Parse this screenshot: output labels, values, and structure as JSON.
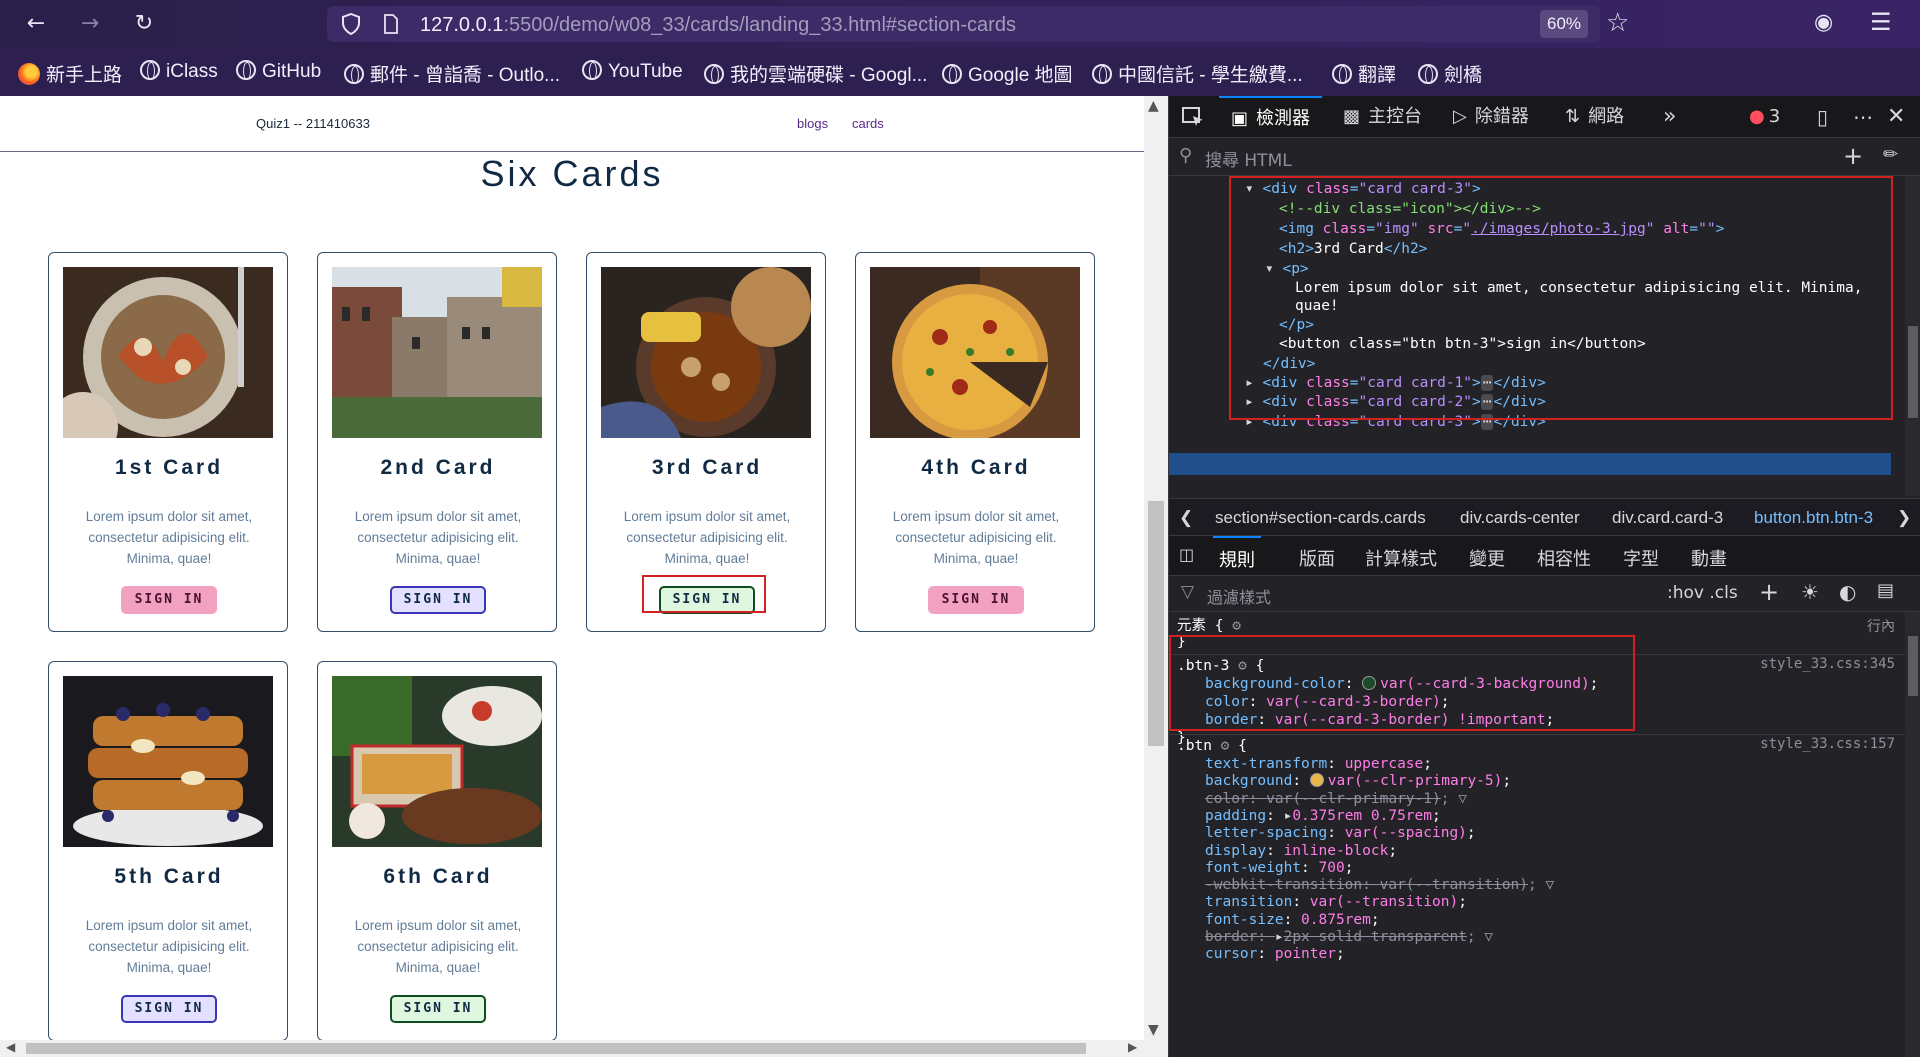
{
  "browser": {
    "url_host": "127.0.0.1",
    "url_rest": ":5500/demo/w08_33/cards/landing_33.html#section-cards",
    "zoom": "60%",
    "bookmarks": [
      "新手上路",
      "iClass",
      "GitHub",
      "郵件 - 曾詣喬 - Outlo...",
      "YouTube",
      "我的雲端硬碟 - Googl...",
      "Google 地圖",
      "中國信託 - 學生繳費...",
      "翻譯",
      "劍橋"
    ]
  },
  "page": {
    "logo": "Quiz1 -- 211410633",
    "nav_links": [
      "blogs",
      "cards"
    ],
    "title": "Six Cards",
    "cards": [
      {
        "title": "1st Card",
        "text": "Lorem ipsum dolor sit amet, consectetur adipisicing elit. Minima, quae!",
        "button": "SIGN IN",
        "btn_class": "btn-1",
        "photo": "pasta"
      },
      {
        "title": "2nd Card",
        "text": "Lorem ipsum dolor sit amet, consectetur adipisicing elit. Minima, quae!",
        "button": "SIGN IN",
        "btn_class": "btn-2",
        "photo": "buildings"
      },
      {
        "title": "3rd Card",
        "text": "Lorem ipsum dolor sit amet, consectetur adipisicing elit. Minima, quae!",
        "button": "SIGN IN",
        "btn_class": "btn-3",
        "photo": "stew"
      },
      {
        "title": "4th Card",
        "text": "Lorem ipsum dolor sit amet, consectetur adipisicing elit. Minima, quae!",
        "button": "SIGN IN",
        "btn_class": "btn-1",
        "photo": "pizza"
      },
      {
        "title": "5th Card",
        "text": "Lorem ipsum dolor sit amet, consectetur adipisicing elit. Minima, quae!",
        "button": "SIGN IN",
        "btn_class": "btn-2",
        "photo": "french-toast"
      },
      {
        "title": "6th Card",
        "text": "Lorem ipsum dolor sit amet, consectetur adipisicing elit. Minima, quae!",
        "button": "SIGN IN",
        "btn_class": "btn-3",
        "photo": "grill"
      }
    ]
  },
  "devtools": {
    "tabs": [
      "檢測器",
      "主控台",
      "除錯器",
      "網路"
    ],
    "error_count": "3",
    "search_placeholder": "搜尋 HTML",
    "breadcrumb": [
      "section#section-cards.cards",
      "div.cards-center",
      "div.card.card-3",
      "button.btn.btn-3"
    ],
    "rules_tabs": [
      "規則",
      "版面",
      "計算樣式",
      "變更",
      "相容性",
      "字型",
      "動畫"
    ],
    "filter_placeholder": "過濾樣式",
    "filter_tools": ":hov  .cls",
    "tree": {
      "card_open": "div class=\"card card-3\"",
      "comment": "<!--div class=\"icon\"></div>-->",
      "img_src": "./images/photo-3.jpg",
      "h2_text": "3rd Card",
      "p_text_1": "Lorem ipsum dolor sit amet, consectetur adipisicing elit. Minima,",
      "p_text_2": "quae!",
      "button_text": "sign in",
      "siblings": [
        "card card-1",
        "card card-2",
        "card card-3"
      ]
    },
    "element_label": "元素 {",
    "inline_label": "行內",
    "rule_btn3": {
      "selector": ".btn-3",
      "source": "style_33.css:345",
      "background": "var(--card-3-background)",
      "color": "var(--card-3-border)",
      "border": "var(--card-3-border) !important"
    },
    "rule_btn": {
      "selector": ".btn",
      "source": "style_33.css:157",
      "lines": [
        [
          "text-transform",
          "uppercase",
          false
        ],
        [
          "background",
          "var(--clr-primary-5)",
          false
        ],
        [
          "color",
          "var(--clr-primary-1)",
          true
        ],
        [
          "padding",
          "0.375rem 0.75rem",
          false
        ],
        [
          "letter-spacing",
          "var(--spacing)",
          false
        ],
        [
          "display",
          "inline-block",
          false
        ],
        [
          "font-weight",
          "700",
          false
        ],
        [
          "-webkit-transition",
          "var(--transition)",
          true
        ],
        [
          "transition",
          "var(--transition)",
          false
        ],
        [
          "font-size",
          "0.875rem",
          false
        ],
        [
          "border",
          "2px solid transparent",
          true
        ],
        [
          "cursor",
          "pointer",
          false
        ]
      ]
    },
    "colors": {
      "btn3_swatch": "#1c4a2a",
      "btn_swatch": "#e8b84a"
    }
  }
}
